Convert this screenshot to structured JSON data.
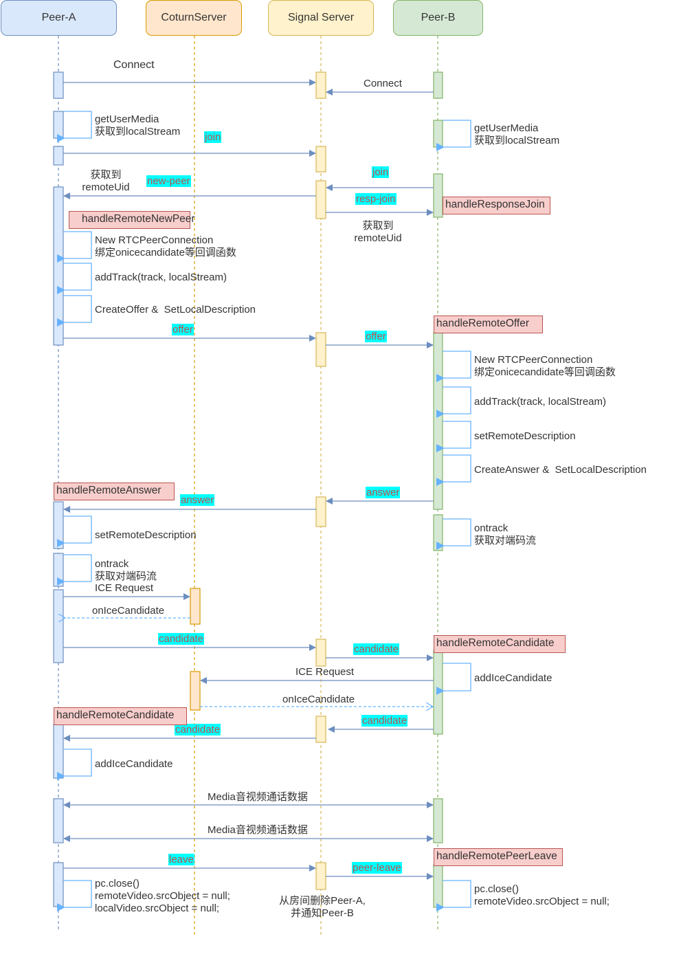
{
  "participants": [
    {
      "id": "peerA",
      "label": "Peer-A",
      "theme": "blue"
    },
    {
      "id": "coturn",
      "label": "CoturnServer",
      "theme": "orange"
    },
    {
      "id": "signal",
      "label": "Signal Server",
      "theme": "yellow"
    },
    {
      "id": "peerB",
      "label": "Peer-B",
      "theme": "green"
    }
  ],
  "colors": {
    "blue_fill": "#dae8fc",
    "blue_stroke": "#6c8ebf",
    "orange_fill": "#ffe6cc",
    "orange_stroke": "#d79b00",
    "yellow_fill": "#fff2cc",
    "yellow_stroke": "#d6b656",
    "green_fill": "#d5e8d4",
    "green_stroke": "#82b366",
    "arrow": "#6c8ebf",
    "self_loop": "#66b2ff",
    "message_highlight": "#00ffff",
    "message_text": "#b85450",
    "handler_fill": "#f8cecc",
    "handler_stroke": "#b85450"
  },
  "labels": {
    "connect_a": "Connect",
    "connect_b": "Connect",
    "getusermedia_a": "getUserMedia\n获取到localStream",
    "getusermedia_b": "getUserMedia\n获取到localStream",
    "got_remote_uid_a": "获取到\nremoteUid",
    "got_remote_uid_b": "获取到\nremoteUid",
    "new_pc_a": "New RTCPeerConnection\n绑定onicecandidate等回调函数",
    "add_track_a": "addTrack(track, localStream)",
    "create_offer": "CreateOffer &  SetLocalDescription",
    "new_pc_b": "New RTCPeerConnection\n绑定onicecandidate等回调函数",
    "add_track_b": "addTrack(track, localStream)",
    "set_remote_b": "setRemoteDescription",
    "create_answer": "CreateAnswer &  SetLocalDescription",
    "set_remote_a": "setRemoteDescription",
    "ontrack_a": "ontrack\n获取对端码流",
    "ontrack_b": "ontrack\n获取对端码流",
    "ice_request_a": "ICE Request",
    "on_ice_candidate_a": "onIceCandidate",
    "ice_request_b": "ICE Request",
    "on_ice_candidate_b": "onIceCandidate",
    "add_ice_b": "addIceCandidate",
    "add_ice_a": "addIceCandidate",
    "media_1": "Media音视频通话数据",
    "media_2": "Media音视频通话数据",
    "close_a": "pc.close()\nremoteVideo.srcObject = null;\nlocalVideo.srcObject = null;",
    "server_remove": "从房间删除Peer-A,\n并通知Peer-B",
    "close_b": "pc.close()\nremoteVideo.srcObject = null;"
  },
  "messages": {
    "join_a": "join",
    "join_b": "join",
    "new_peer": "new-peer",
    "resp_join": "resp-join",
    "offer_a": "offer",
    "offer_b": "offer",
    "answer_b": "answer",
    "answer_a": "answer",
    "candidate_a_to_s": "candidate",
    "candidate_s_to_b": "candidate",
    "candidate_b_to_s": "candidate",
    "candidate_s_to_a": "candidate",
    "leave": "leave",
    "peer_leave": "peer-leave"
  },
  "handlers": {
    "response_join": "handleResponseJoin",
    "remote_new_peer": "handleRemoteNewPeer",
    "remote_offer": "handleRemoteOffer",
    "remote_answer": "handleRemoteAnswer",
    "remote_candidate_b": "handleRemoteCandidate",
    "remote_candidate_a": "handleRemoteCandidate",
    "remote_peer_leave": "handleRemotePeerLeave"
  }
}
